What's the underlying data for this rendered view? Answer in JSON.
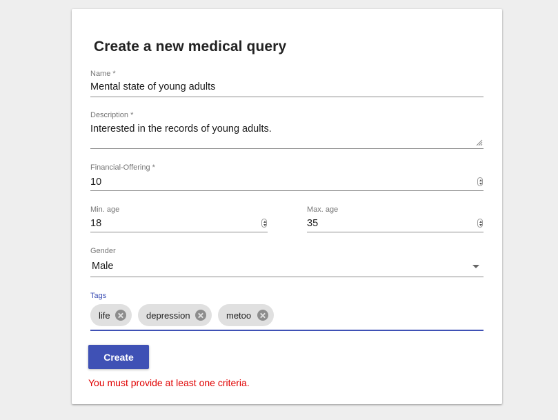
{
  "form": {
    "title": "Create a new medical query",
    "name": {
      "label": "Name *",
      "value": "Mental state of young adults"
    },
    "description": {
      "label": "Description *",
      "value": "Interested in the records of young adults."
    },
    "financial_offering": {
      "label": "Financial-Offering *",
      "value": "10"
    },
    "min_age": {
      "label": "Min. age",
      "value": "18"
    },
    "max_age": {
      "label": "Max. age",
      "value": "35"
    },
    "gender": {
      "label": "Gender",
      "value": "Male"
    },
    "tags": {
      "label": "Tags",
      "items": [
        "life",
        "depression",
        "metoo"
      ]
    },
    "create_button": "Create",
    "error_message": "You must provide at least one criteria."
  },
  "colors": {
    "primary": "#3f51b5",
    "error": "#e00000",
    "chip_background": "#e0e0e0",
    "page_background": "#eeeeee"
  }
}
